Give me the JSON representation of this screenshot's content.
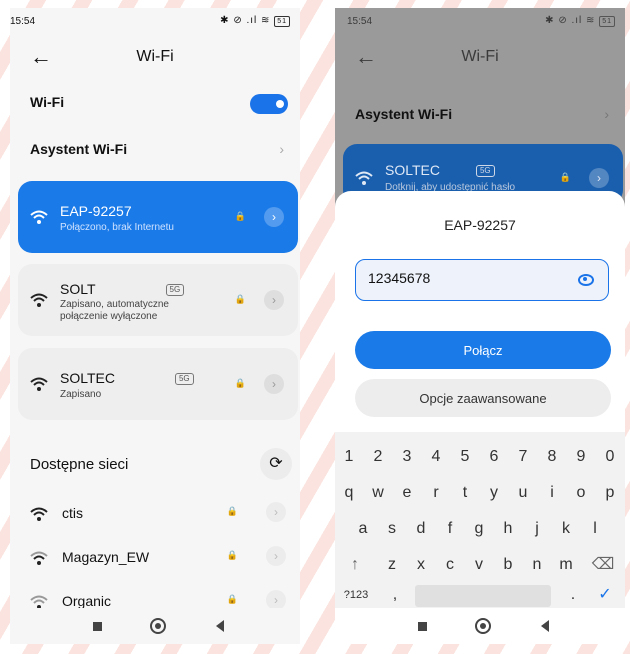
{
  "left": {
    "status": {
      "time": "15:54",
      "icons": "✱ ⊘ .ıl ≋",
      "battery": "51"
    },
    "header": {
      "title": "Wi-Fi"
    },
    "wifi_row": {
      "label": "Wi-Fi"
    },
    "assistant_row": {
      "label": "Asystent Wi-Fi"
    },
    "saved": [
      {
        "name": "EAP-92257",
        "status": "Połączono, brak Internetu"
      },
      {
        "name": "SOLT",
        "tag": "5G",
        "status_line1": "Zapisano, automatyczne",
        "status_line2": "połączenie wyłączone"
      },
      {
        "name": "SOLTEC",
        "tag": "5G",
        "status": "Zapisano"
      }
    ],
    "available_title": "Dostępne sieci",
    "available": [
      {
        "name": "ctis"
      },
      {
        "name": "Magazyn_EW"
      },
      {
        "name": "Organic"
      }
    ]
  },
  "right": {
    "status": {
      "time": "15:54",
      "icons": "✱ ⊘ .ıl ≋",
      "battery": "51"
    },
    "header": {
      "title": "Wi-Fi"
    },
    "assistant_row": {
      "label": "Asystent Wi-Fi"
    },
    "dim_card": {
      "name": "SOLTEC",
      "tag": "5G",
      "status": "Dotknij, aby udostępnić hasło"
    },
    "dialog": {
      "title": "EAP-92257",
      "password_value": "12345678",
      "connect_label": "Połącz",
      "advanced_label": "Opcje zaawansowane"
    },
    "keyboard": {
      "numbers": [
        "1",
        "2",
        "3",
        "4",
        "5",
        "6",
        "7",
        "8",
        "9",
        "0"
      ],
      "row1": [
        "q",
        "w",
        "e",
        "r",
        "t",
        "y",
        "u",
        "i",
        "o",
        "p"
      ],
      "row2": [
        "a",
        "s",
        "d",
        "f",
        "g",
        "h",
        "j",
        "k",
        "l"
      ],
      "row3_shift": "↑",
      "row3": [
        "z",
        "x",
        "c",
        "v",
        "b",
        "n",
        "m"
      ],
      "row3_backspace": "⌫",
      "sym": "?123",
      "comma": ",",
      "period": ".",
      "enter": "✓"
    }
  }
}
